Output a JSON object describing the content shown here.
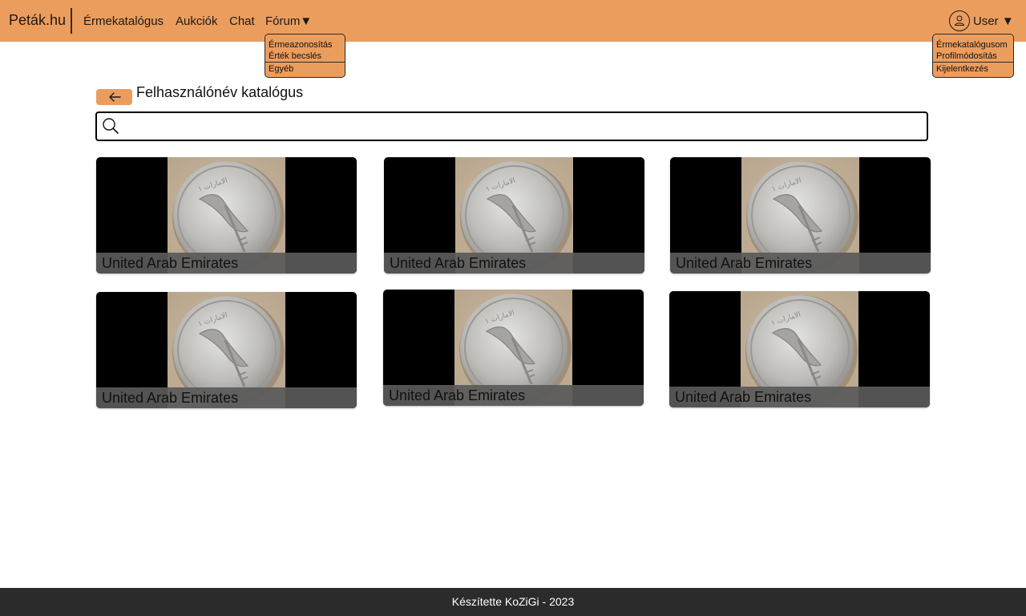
{
  "navbar": {
    "brand": "Peták.hu",
    "links": [
      "Érmekatalógus",
      "Aukciók",
      "Chat",
      "Fórum▼"
    ],
    "user_label": "User ▼",
    "icons": {
      "user": "user-circle-icon"
    }
  },
  "forum_menu": {
    "items": [
      "Érmeazonosítás",
      "Érték becslés",
      "Egyéb"
    ]
  },
  "user_menu": {
    "items": [
      "Érmekatalógusom",
      "Profilmódosítás",
      "Kijelentkezés"
    ]
  },
  "main": {
    "title": "Felhasználónév katalógus",
    "back_icon": "arrow-left-icon",
    "search": {
      "value": "",
      "placeholder": "",
      "icon": "search-icon"
    },
    "cards": [
      {
        "caption": "United Arab Emirates"
      },
      {
        "caption": "United Arab Emirates"
      },
      {
        "caption": "United Arab Emirates"
      },
      {
        "caption": "United Arab Emirates"
      },
      {
        "caption": "United Arab Emirates"
      },
      {
        "caption": "United Arab Emirates"
      }
    ]
  },
  "footer": {
    "text": "Készítette KoZiGi - 2023"
  },
  "colors": {
    "accent": "#eb9d5e",
    "footer_bg": "#2b2b2b",
    "card_bg": "#000000"
  }
}
